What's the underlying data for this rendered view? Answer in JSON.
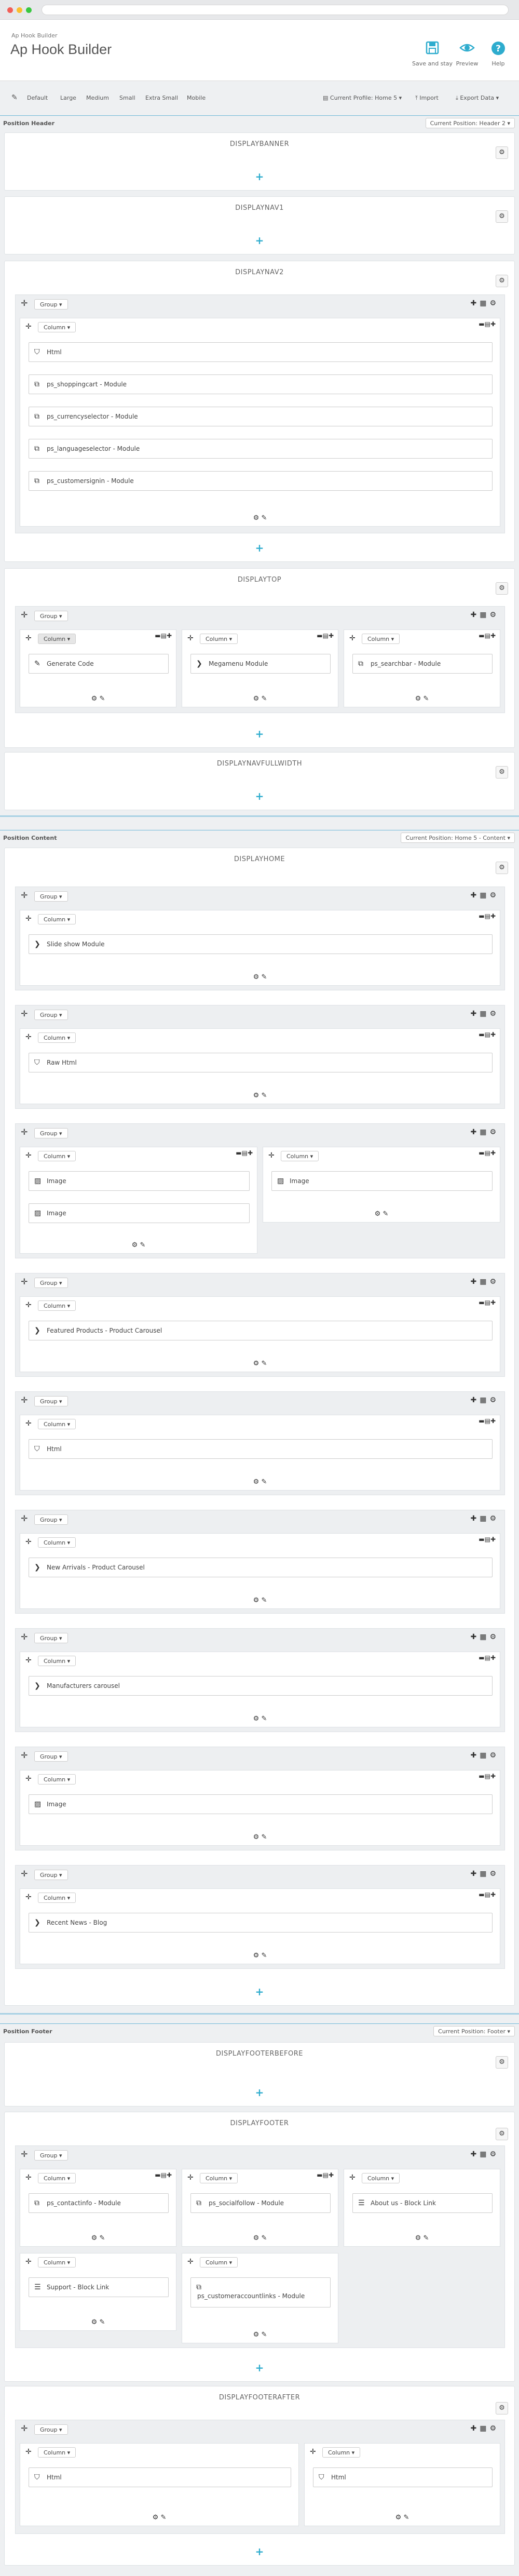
{
  "header": {
    "breadcrumb": "Ap Hook Builder",
    "title": "Ap Hook Builder",
    "actions": [
      {
        "label": "Save and stay",
        "icon": "save-icon"
      },
      {
        "label": "Preview",
        "icon": "eye-icon"
      },
      {
        "label": "Help",
        "icon": "help-icon"
      }
    ]
  },
  "toolbar": {
    "devices": [
      "Default",
      "Large",
      "Medium",
      "Small",
      "Extra Small",
      "Mobile"
    ],
    "profile": "Current Profile: Home 5 ▾",
    "import": "Import",
    "export": "Export Data ▾"
  },
  "labels": {
    "group": "Group ▾",
    "column": "Column ▾"
  },
  "positions": [
    {
      "title": "Position Header",
      "select": "Current Position: Header 2 ▾"
    },
    {
      "title": "Position Content",
      "select": "Current Position: Home 5 - Content ▾"
    },
    {
      "title": "Position Footer",
      "select": "Current Position: Footer ▾"
    }
  ],
  "hooks": [
    {
      "name": "DISPLAYBANNER"
    },
    {
      "name": "DISPLAYNAV1"
    },
    {
      "name": "DISPLAYNAV2"
    },
    {
      "name": "DISPLAYTOP"
    },
    {
      "name": "DISPLAYNAVFULLWIDTH"
    },
    {
      "name": "DISPLAYHOME"
    },
    {
      "name": "DISPLAYFOOTERBEFORE"
    },
    {
      "name": "DISPLAYFOOTER"
    },
    {
      "name": "DISPLAYFOOTERAFTER"
    }
  ],
  "widgets": {
    "nav2": [
      "Html",
      "ps_shoppingcart - Module",
      "ps_currencyselector - Module",
      "ps_languageselector - Module",
      "ps_customersignin - Module"
    ],
    "top": [
      "Generate Code",
      "Megamenu Module",
      "ps_searchbar - Module"
    ],
    "home": [
      "Slide show Module",
      "Raw Html",
      "Image",
      "Image",
      "Image",
      "Featured Products - Product Carousel",
      "Html",
      "New Arrivals - Product Carousel",
      "Manufacturers carousel",
      "Image",
      "Recent News - Blog"
    ],
    "footer": [
      "ps_contactinfo - Module",
      "ps_socialfollow - Module",
      "About us - Block Link",
      "Support - Block Link",
      "ps_customeraccountlinks - Module"
    ],
    "footerafter": [
      "Html",
      "Html"
    ]
  },
  "colors": {
    "accent": "#2eacce",
    "background": "#eef0f2",
    "border": "#dde1e4"
  }
}
